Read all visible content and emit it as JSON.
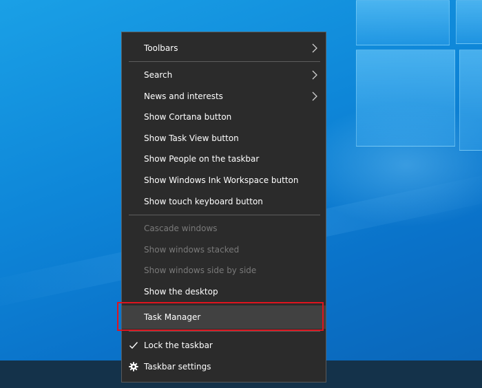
{
  "menu": {
    "items": [
      {
        "label": "Toolbars",
        "submenu": true,
        "enabled": true
      },
      {
        "label": "Search",
        "submenu": true,
        "enabled": true
      },
      {
        "label": "News and interests",
        "submenu": true,
        "enabled": true
      },
      {
        "label": "Show Cortana button",
        "submenu": false,
        "enabled": true
      },
      {
        "label": "Show Task View button",
        "submenu": false,
        "enabled": true
      },
      {
        "label": "Show People on the taskbar",
        "submenu": false,
        "enabled": true
      },
      {
        "label": "Show Windows Ink Workspace button",
        "submenu": false,
        "enabled": true
      },
      {
        "label": "Show touch keyboard button",
        "submenu": false,
        "enabled": true
      },
      {
        "label": "Cascade windows",
        "submenu": false,
        "enabled": false
      },
      {
        "label": "Show windows stacked",
        "submenu": false,
        "enabled": false
      },
      {
        "label": "Show windows side by side",
        "submenu": false,
        "enabled": false
      },
      {
        "label": "Show the desktop",
        "submenu": false,
        "enabled": true
      },
      {
        "label": "Task Manager",
        "submenu": false,
        "enabled": true,
        "highlighted": true
      },
      {
        "label": "Lock the taskbar",
        "submenu": false,
        "enabled": true,
        "checked": true
      },
      {
        "label": "Taskbar settings",
        "submenu": false,
        "enabled": true,
        "icon": "gear-icon"
      }
    ]
  },
  "colors": {
    "menu_bg": "#2b2b2b",
    "highlight_bg": "#414141",
    "disabled_text": "#7a7a7a",
    "annotation_red": "#e0141e",
    "desktop_blue": "#0e86d8"
  }
}
